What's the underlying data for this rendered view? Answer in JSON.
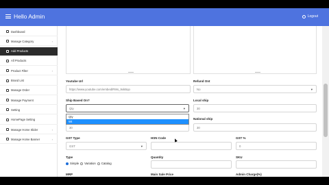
{
  "header": {
    "title": "Hello Admin",
    "logout_label": "Logout"
  },
  "sidebar": {
    "items": [
      {
        "label": "Dashboard",
        "chevron": false,
        "active": false
      },
      {
        "label": "Manage Category",
        "chevron": true,
        "active": false
      },
      {
        "label": "Add Products",
        "chevron": false,
        "active": true
      },
      {
        "label": "All Products",
        "chevron": false,
        "active": false
      },
      {
        "label": "Product Filter",
        "chevron": true,
        "active": false
      },
      {
        "label": "Brand List",
        "chevron": false,
        "active": false
      },
      {
        "label": "Manage Order",
        "chevron": false,
        "active": false
      },
      {
        "label": "Manage Payment",
        "chevron": false,
        "active": false
      },
      {
        "label": "Setting",
        "chevron": false,
        "active": false
      },
      {
        "label": "HomePage Setting",
        "chevron": false,
        "active": false
      },
      {
        "label": "Manage Home Slider",
        "chevron": true,
        "active": false
      },
      {
        "label": "Manage Home Banner",
        "chevron": true,
        "active": false
      }
    ]
  },
  "form": {
    "youtube_url": {
      "label": "Youtube Url",
      "value": "https://www.youtube.com/embed/R9Is_9xkBqo"
    },
    "refund_ont": {
      "label": "Refund Ont",
      "value": "No"
    },
    "ship_based_on": {
      "label": "Ship Based On?",
      "value": "Qty",
      "options": [
        "Qty",
        "Wt"
      ],
      "highlighted": "Wt"
    },
    "local_ship": {
      "label": "Local ship",
      "value": "30"
    },
    "national_ship": {
      "label": "National ship",
      "value": "30"
    },
    "extra_value": "30",
    "gst_type": {
      "label": "GST Type",
      "value": "GST"
    },
    "hsn_code": {
      "label": "HSN Code",
      "value": ""
    },
    "gst_percent": {
      "label": "GST %",
      "value": "0"
    },
    "type": {
      "label": "Type",
      "options": [
        "Simple",
        "Variation",
        "Catalog"
      ],
      "selected": "Simple"
    },
    "quantity": {
      "label": "Quantity"
    },
    "sku": {
      "label": "SKU"
    },
    "mrp": {
      "label": "MRP"
    },
    "main_sale_price": {
      "label": "Main Sale Price"
    },
    "admin_charge": {
      "label": "Admin Charge(%)"
    }
  },
  "colors": {
    "header": "#4e73df",
    "active_sidebar": "#2b2b2b",
    "highlight": "#1e90ff"
  }
}
